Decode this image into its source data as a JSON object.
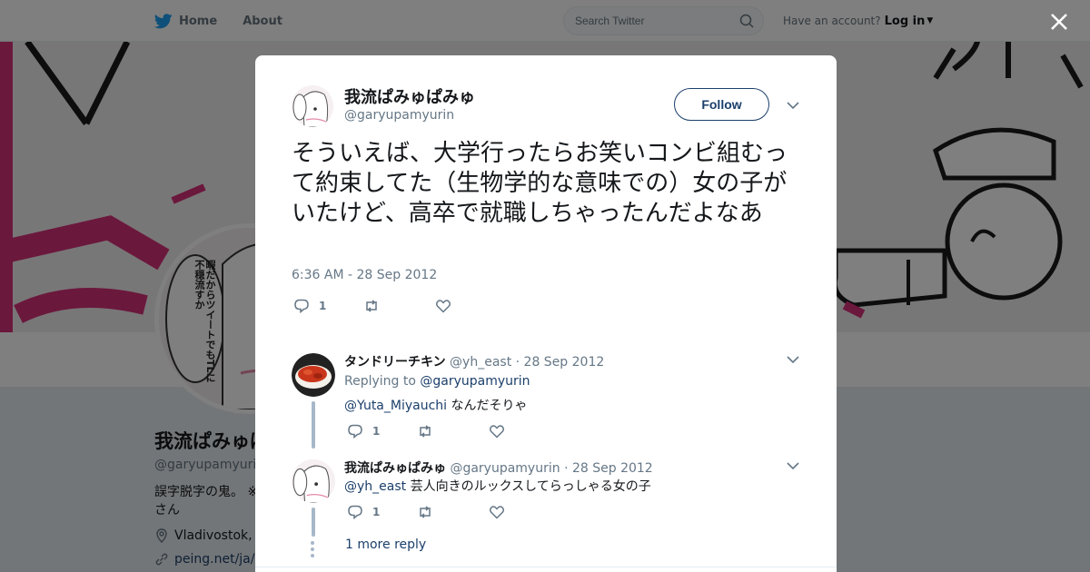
{
  "header": {
    "home_label": "Home",
    "about_label": "About",
    "search_placeholder": "Search Twitter",
    "have_account": "Have an account?",
    "login_label": "Log in"
  },
  "profile": {
    "name": "我流ぱみゅぱみゅ",
    "handle": "@garyupamyurin",
    "bio": "誤字脱字の鬼。 ※",
    "bio_line2": "さん",
    "location": "Vladivostok, R",
    "link": "peing.net/ja/ga",
    "avatar_bubble_text": "暇だからツイートでもTLに不穏流すか"
  },
  "tweet": {
    "author_name": "我流ぱみゅぱみゅ",
    "author_handle": "@garyupamyurin",
    "follow_label": "Follow",
    "text": "そういえば、大学行ったらお笑いコンビ組むって約束してた（生物学的な意味での）女の子がいたけど、高卒で就職しちゃったんだよなあ",
    "timestamp": "6:36 AM - 28 Sep 2012",
    "reply_count": "1"
  },
  "replies": [
    {
      "name": "タンドリーチキン",
      "handle": "@yh_east",
      "sep": "·",
      "date": "28 Sep 2012",
      "replying_to_label": "Replying to",
      "replying_to_handle": "@garyupamyurin",
      "mention": "@Yuta_Miyauchi",
      "text": " なんだそりゃ",
      "reply_count": "1"
    },
    {
      "name": "我流ぱみゅぱみゅ",
      "handle": "@garyupamyurin",
      "sep": "·",
      "date": "28 Sep 2012",
      "mention": "@yh_east",
      "text": " 芸人向きのルックスしてらっしゃる女の子",
      "reply_count": "1"
    }
  ],
  "more_replies_label": "1 more reply",
  "colors": {
    "link": "#1b3f6b",
    "muted": "#657786",
    "banner_pink": "#d6307a",
    "thread_line": "#a6b7c9"
  }
}
